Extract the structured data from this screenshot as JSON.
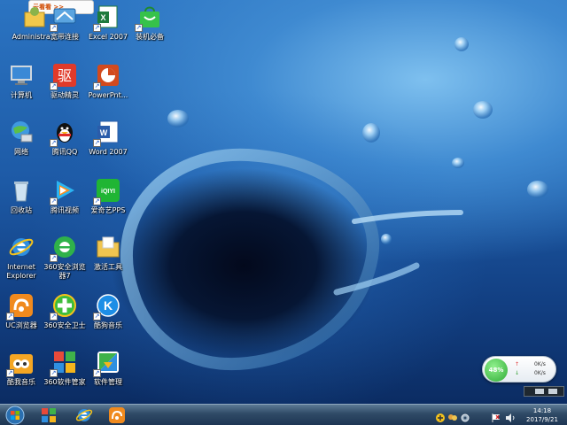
{
  "desktop": {
    "icons": [
      {
        "id": "admin",
        "label": "Administra...",
        "icon": "user-folder-icon"
      },
      {
        "id": "broadband",
        "label": "宽带连接",
        "icon": "network-connection-icon"
      },
      {
        "id": "excel",
        "label": "Excel 2007",
        "icon": "excel-icon"
      },
      {
        "id": "shopping",
        "label": "装机必备",
        "icon": "shopping-bag-icon"
      },
      {
        "id": "computer",
        "label": "计算机",
        "icon": "computer-icon"
      },
      {
        "id": "driver",
        "label": "驱动精灵",
        "icon": "driver-genius-icon",
        "glyph": "驱"
      },
      {
        "id": "powerpoint",
        "label": "PowerPnt...",
        "icon": "powerpoint-icon"
      },
      {
        "id": "network",
        "label": "网络",
        "icon": "network-globe-icon"
      },
      {
        "id": "qq",
        "label": "腾讯QQ",
        "icon": "qq-penguin-icon"
      },
      {
        "id": "word",
        "label": "Word 2007",
        "icon": "word-icon"
      },
      {
        "id": "recycle",
        "label": "回收站",
        "icon": "recycle-bin-icon"
      },
      {
        "id": "tencent-video",
        "label": "腾讯视频",
        "icon": "tencent-video-icon"
      },
      {
        "id": "iqiyi",
        "label": "爱奇艺PPS",
        "icon": "iqiyi-icon",
        "glyph": "iQIYI"
      },
      {
        "id": "ie",
        "label": "Internet\nExplorer",
        "icon": "internet-explorer-icon"
      },
      {
        "id": "360browser",
        "label": "360安全浏览\n器7",
        "icon": "360-browser-icon"
      },
      {
        "id": "activate",
        "label": "激活工具",
        "icon": "folder-icon"
      },
      {
        "id": "uc",
        "label": "UC浏览器",
        "icon": "uc-browser-icon"
      },
      {
        "id": "360safe",
        "label": "360安全卫士",
        "icon": "360-safe-icon"
      },
      {
        "id": "kugou",
        "label": "酷狗音乐",
        "icon": "kugou-music-icon",
        "glyph": "K"
      },
      {
        "id": "kuwo",
        "label": "酷我音乐",
        "icon": "kuwo-music-icon"
      },
      {
        "id": "360soft",
        "label": "360软件管家",
        "icon": "360-software-manager-icon"
      },
      {
        "id": "softmgr",
        "label": "软件管理",
        "icon": "software-manager-icon"
      }
    ],
    "top_widget": {
      "text": "云看看 >>",
      "icon": "top-widget-icon"
    }
  },
  "net_monitor": {
    "percent": "48%",
    "upload": "0K/s",
    "download": "0K/s",
    "upload_arrow": "↑",
    "download_arrow": "↓"
  },
  "taskbar": {
    "start": "start-orb-icon",
    "pinned": [
      "apps-grid-icon",
      "internet-explorer-icon",
      "uc-browser-icon"
    ],
    "tray_icons": [
      "tray-network-icon",
      "tray-people-icon",
      "tray-settings-icon",
      "tray-flag-icon",
      "tray-volume-icon"
    ],
    "clock_time": "14:18",
    "clock_date": "2017/9/21"
  },
  "colors": {
    "taskbar": "#2f4a66",
    "label_text": "#ffffff",
    "accent_green": "#2fab36"
  }
}
